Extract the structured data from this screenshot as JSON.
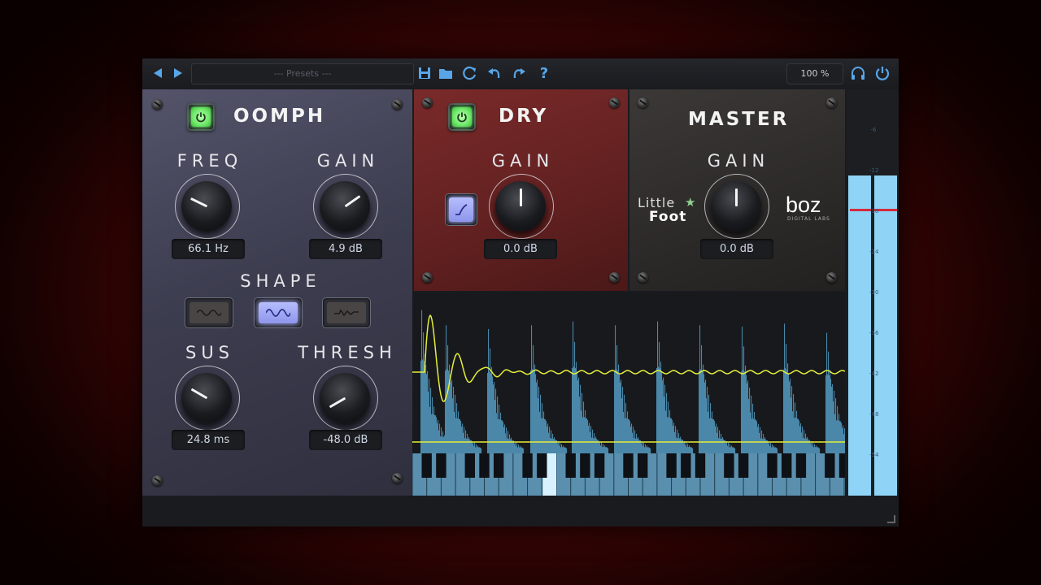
{
  "toolbar": {
    "presets_placeholder": "--- Presets ---",
    "zoom": "100 %",
    "icons": [
      "prev-preset-icon",
      "next-preset-icon",
      "save-icon",
      "folder-icon",
      "refresh-icon",
      "undo-icon",
      "redo-icon",
      "help-icon",
      "headphones-icon",
      "power-icon"
    ],
    "help_glyph": "?"
  },
  "oomph": {
    "title": "OOMPH",
    "enabled": true,
    "freq_label": "FREQ",
    "freq_value": "66.1 Hz",
    "gain_label": "GAIN",
    "gain_value": "4.9 dB",
    "shape_label": "SHAPE",
    "shape_options": [
      "shape-1",
      "shape-2",
      "shape-3"
    ],
    "shape_selected": 2,
    "sus_label": "SUS",
    "sus_value": "24.8 ms",
    "thresh_label": "THRESH",
    "thresh_value": "-48.0 dB"
  },
  "dry": {
    "title": "DRY",
    "enabled": true,
    "gain_label": "GAIN",
    "gain_value": "0.0 dB"
  },
  "master": {
    "title": "MASTER",
    "gain_label": "GAIN",
    "gain_value": "0.0 dB",
    "logo_littlefoot_line1": "Little",
    "logo_littlefoot_line2": "Foot",
    "logo_boz": "boz",
    "logo_boz_sub": "DIGITAL LABS"
  },
  "meter": {
    "scale": [
      "-6",
      "-12",
      "-18",
      "-24",
      "-30",
      "-36",
      "-42",
      "-48",
      "-54"
    ],
    "colors": {
      "bar": "#8fd3f6",
      "peak": "#d42a3a"
    }
  },
  "colors": {
    "accent": "#58a6e8",
    "power_on": "#7dff77",
    "scope_wave": "#e6ef3a",
    "scope_bars": "#4b87a8"
  }
}
